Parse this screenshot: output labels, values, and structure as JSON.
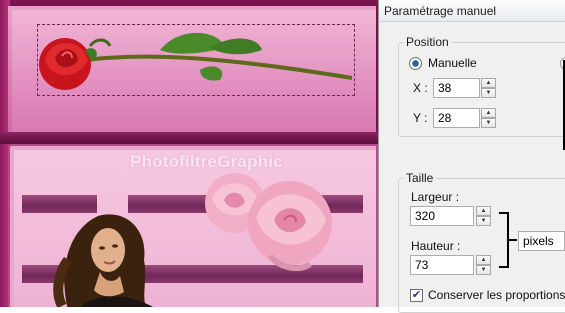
{
  "canvas": {
    "watermark": "PhotofiltreGraphic"
  },
  "dialog": {
    "title": "Paramétrage manuel",
    "position": {
      "legend": "Position",
      "mode_label": "Manuelle",
      "x_label": "X :",
      "x_value": "38",
      "y_label": "Y :",
      "y_value": "28"
    },
    "size": {
      "legend": "Taille",
      "width_label": "Largeur :",
      "width_value": "320",
      "height_label": "Hauteur :",
      "height_value": "73",
      "units": "pixels",
      "keep_ratio_label": "Conserver les proportions",
      "keep_ratio_checked": true
    }
  },
  "icons": {
    "radio": "radio-selected-icon",
    "spin_up": "spin-up-icon",
    "spin_down": "spin-down-icon",
    "check": "checkmark-icon"
  }
}
